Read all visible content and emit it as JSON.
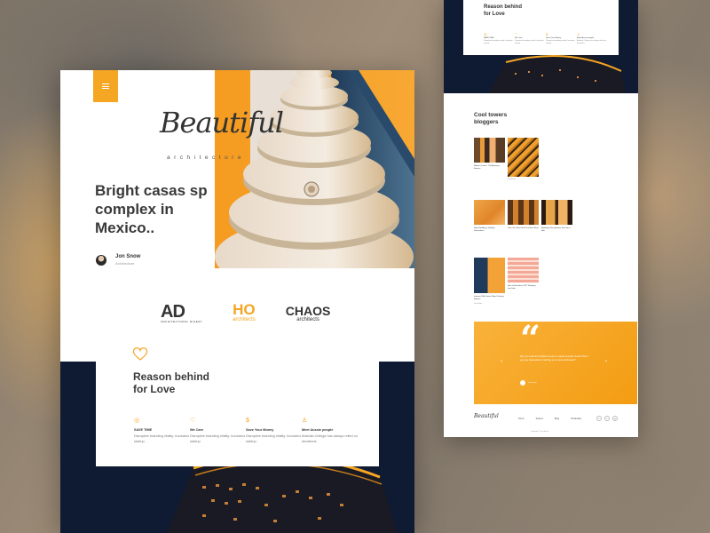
{
  "colors": {
    "accent": "#f5a623",
    "dark": "#0f1a33",
    "text": "#3a3a3a"
  },
  "left": {
    "menu_icon": "hamburger-icon",
    "logo": {
      "script": "Beautiful",
      "sub": "architecture"
    },
    "headline": "Bright casas sp complex in Mexico..",
    "author": {
      "name": "Jon Snow",
      "role": "Architecture"
    },
    "brands": [
      {
        "big": "AD",
        "small": "ARCHITECTURAL DIGEST"
      },
      {
        "big": "HO",
        "small": "architects"
      },
      {
        "big": "CHAOS",
        "small": "architects"
      }
    ],
    "reason": {
      "title": "Reason behind\nfor Love",
      "features": [
        {
          "icon": "target-icon",
          "title": "SAVE TIME",
          "desc": "Disruptive branding vitality. Incubator startup."
        },
        {
          "icon": "heart-icon",
          "title": "We Care",
          "desc": "Disruptive branding vitality. Incubator startup."
        },
        {
          "icon": "dollar-icon",
          "title": "Save Your Money",
          "desc": "Disruptive branding vitality. Incubator startup."
        },
        {
          "icon": "person-icon",
          "title": "Meet Aussie people",
          "desc": "Abstulia College has always relied on donations"
        }
      ]
    }
  },
  "right": {
    "reason": {
      "title": "Reason behind\nfor Love",
      "features": [
        {
          "title": "SAVE TIME",
          "desc": "Disruptive branding vitality. Incubator startup."
        },
        {
          "title": "We Care",
          "desc": "Disruptive branding vitality. Incubator startup."
        },
        {
          "title": "Save Your Money",
          "desc": "Disruptive branding vitality. Incubator startup."
        },
        {
          "title": "Meet Aussie people",
          "desc": "Abstulia College has always relied on donations"
        }
      ]
    },
    "section_title": "Cool towers\nbloggers",
    "posts": [
      {
        "title": "Modern Lovers: The Amazing Houses",
        "author": "",
        "hue": "tower"
      },
      {
        "title": "",
        "author": "Jon Snow",
        "hue": "gold"
      },
      {
        "title": "Wake-Building's Healthy Subscribers",
        "author": "",
        "hue": "orange"
      },
      {
        "title": "Take Your Best Shot The Best Work",
        "author": "",
        "hue": "brownish"
      },
      {
        "title": "Modelling Precipitation Structure's Rite",
        "author": "",
        "hue": "goldwin"
      },
      {
        "title": "Interiors With Some Wood Cooling System",
        "author": "Jon Snow",
        "hue": "bluegold"
      },
      {
        "title": "How to Revitalise 2017 Sleeping Into Sale",
        "author": "",
        "hue": "pinkgrid"
      }
    ],
    "quote": {
      "text": "Did you read the Opthics Code or maybe another book? Did it got you interested in training your own purchases?",
      "author": "Jon Snow"
    },
    "footer": {
      "logo": "Beautiful",
      "nav": [
        "Home",
        "Spaces",
        "Blog",
        "Vocabulary"
      ],
      "copy": "Copyright © Jon Snow"
    }
  }
}
